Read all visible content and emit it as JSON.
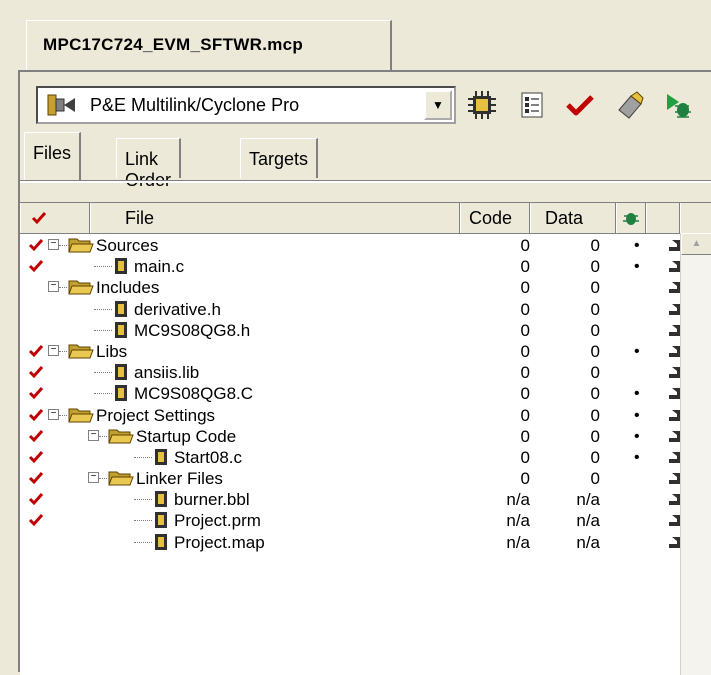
{
  "document_tab": {
    "label": "MPC17C724_EVM_SFTWR.mcp"
  },
  "toolbar": {
    "target_select": {
      "value": "P&E Multilink/Cyclone Pro"
    },
    "buttons": [
      {
        "icon": "chip-icon"
      },
      {
        "icon": "settings-list-icon"
      },
      {
        "icon": "check-icon"
      },
      {
        "icon": "make-icon"
      },
      {
        "icon": "debug-icon"
      }
    ]
  },
  "subtabs": [
    {
      "label": "Files",
      "active": true
    },
    {
      "label": "Link Order",
      "active": false
    },
    {
      "label": "Targets",
      "active": false
    }
  ],
  "columns": {
    "file": "File",
    "code": "Code",
    "data": "Data"
  },
  "rows": [
    {
      "name": "Sources",
      "type": "folder",
      "level": 0,
      "checked": true,
      "code": "0",
      "data": "0",
      "dot": "•"
    },
    {
      "name": "main.c",
      "type": "file",
      "level": 1,
      "checked": true,
      "code": "0",
      "data": "0",
      "dot": "•"
    },
    {
      "name": "Includes",
      "type": "folder",
      "level": 0,
      "checked": false,
      "code": "0",
      "data": "0",
      "dot": ""
    },
    {
      "name": "derivative.h",
      "type": "file",
      "level": 1,
      "checked": false,
      "code": "0",
      "data": "0",
      "dot": ""
    },
    {
      "name": "MC9S08QG8.h",
      "type": "file",
      "level": 1,
      "checked": false,
      "code": "0",
      "data": "0",
      "dot": ""
    },
    {
      "name": "Libs",
      "type": "folder",
      "level": 0,
      "checked": true,
      "code": "0",
      "data": "0",
      "dot": "•"
    },
    {
      "name": "ansiis.lib",
      "type": "file",
      "level": 1,
      "checked": true,
      "code": "0",
      "data": "0",
      "dot": ""
    },
    {
      "name": "MC9S08QG8.C",
      "type": "file",
      "level": 1,
      "checked": true,
      "code": "0",
      "data": "0",
      "dot": "•"
    },
    {
      "name": "Project Settings",
      "type": "folder",
      "level": 0,
      "checked": true,
      "code": "0",
      "data": "0",
      "dot": "•"
    },
    {
      "name": "Startup Code",
      "type": "folder",
      "level": 1,
      "checked": true,
      "code": "0",
      "data": "0",
      "dot": "•"
    },
    {
      "name": "Start08.c",
      "type": "file",
      "level": 2,
      "checked": true,
      "code": "0",
      "data": "0",
      "dot": "•"
    },
    {
      "name": "Linker Files",
      "type": "folder",
      "level": 1,
      "checked": true,
      "code": "0",
      "data": "0",
      "dot": ""
    },
    {
      "name": "burner.bbl",
      "type": "file",
      "level": 2,
      "checked": true,
      "code": "n/a",
      "data": "n/a",
      "dot": ""
    },
    {
      "name": "Project.prm",
      "type": "file",
      "level": 2,
      "checked": true,
      "code": "n/a",
      "data": "n/a",
      "dot": ""
    },
    {
      "name": "Project.map",
      "type": "file",
      "level": 2,
      "checked": false,
      "code": "n/a",
      "data": "n/a",
      "dot": ""
    }
  ],
  "colors": {
    "check": "#c00000",
    "folder": "#e8c850",
    "file": "#303030"
  }
}
